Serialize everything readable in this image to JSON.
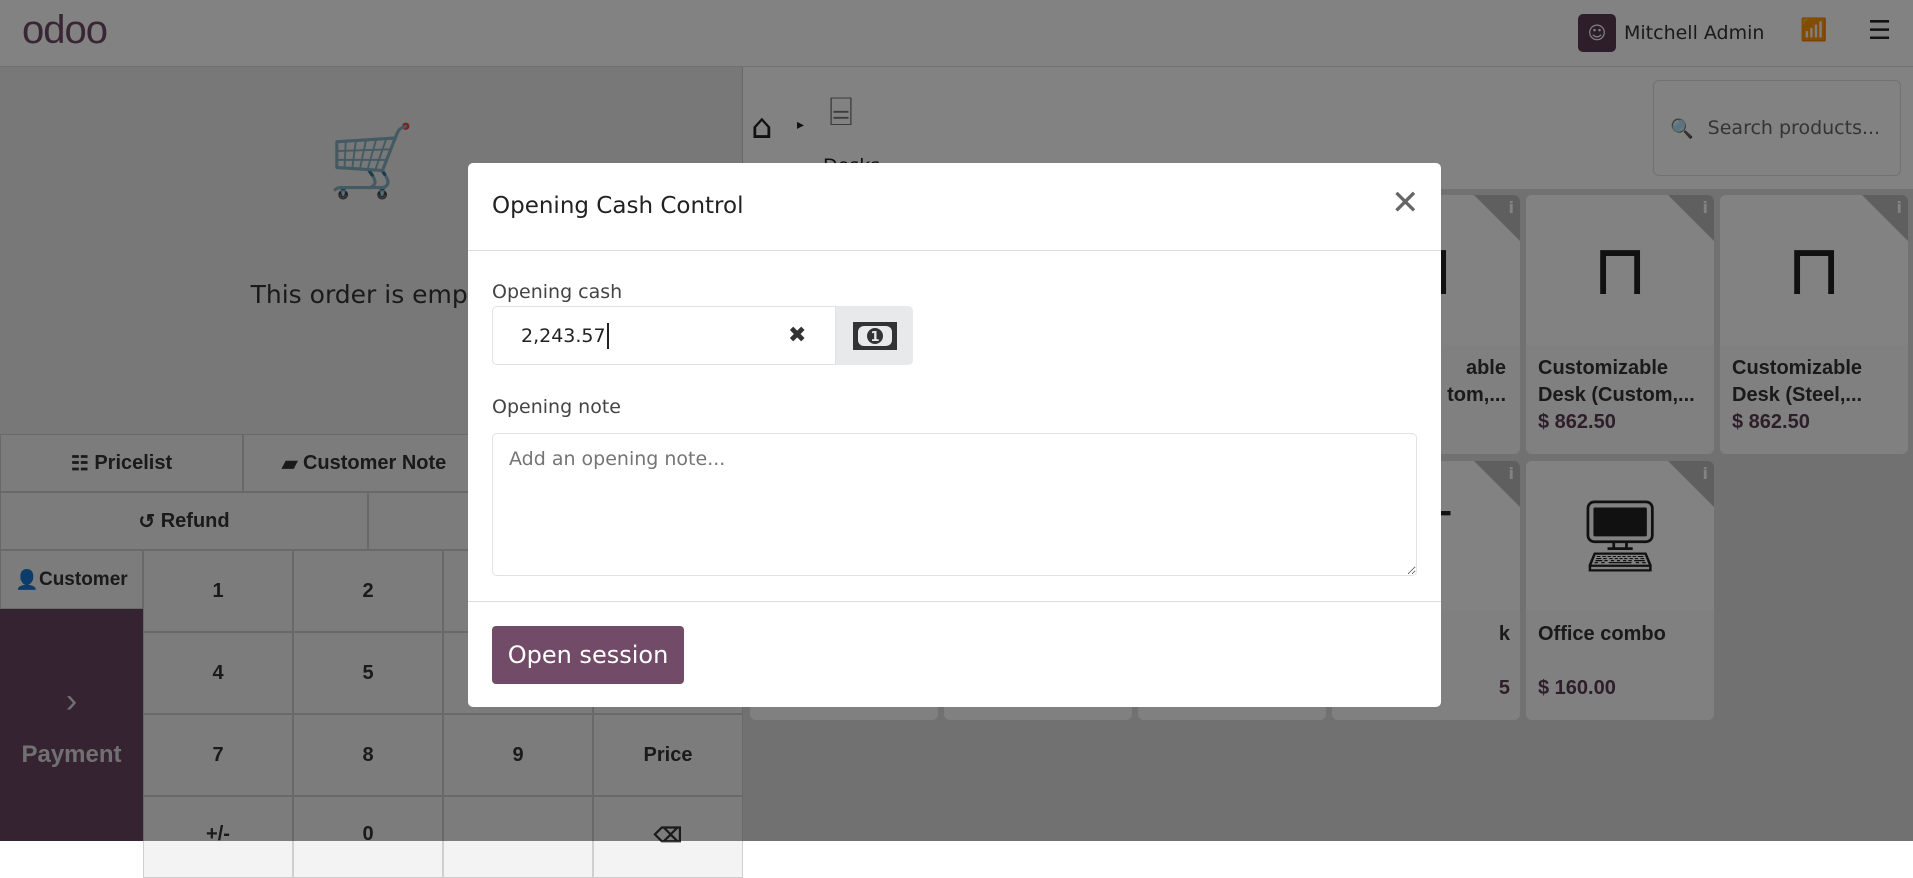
{
  "header": {
    "logo": "odoo",
    "user": "Mitchell Admin",
    "wifi_icon": "wifi-icon",
    "menu_icon": "hamburger-icon"
  },
  "order": {
    "empty_text": "This order is empty"
  },
  "actions": {
    "pricelist": "Pricelist",
    "customer_note": "Customer Note",
    "refund": "Refund",
    "customer": "Customer",
    "payment": "Payment"
  },
  "numpad": [
    "1",
    "2",
    "4",
    "5",
    "7",
    "8",
    "9",
    "Price",
    "+/-",
    "0"
  ],
  "category": {
    "label": "Desks"
  },
  "search": {
    "placeholder": "Search products..."
  },
  "products": [
    {
      "name_fragment_1": "able",
      "name_fragment_2": "tom,..."
    },
    {
      "name": "Customizable Desk (Custom,...",
      "price": "$ 862.50"
    },
    {
      "name": "Customizable Desk (Steel,...",
      "price": "$ 862.50"
    },
    {
      "name_fragment": "k",
      "price_fragment": "5"
    },
    {
      "name": "Office combo",
      "price": "$ 160.00"
    }
  ],
  "modal": {
    "title": "Opening Cash Control",
    "opening_cash_label": "Opening cash",
    "opening_cash_value": "2,243.57",
    "opening_note_label": "Opening note",
    "opening_note_placeholder": "Add an opening note...",
    "open_button": "Open session"
  },
  "colors": {
    "brand": "#714B67",
    "payment_bg": "#6a4562"
  }
}
